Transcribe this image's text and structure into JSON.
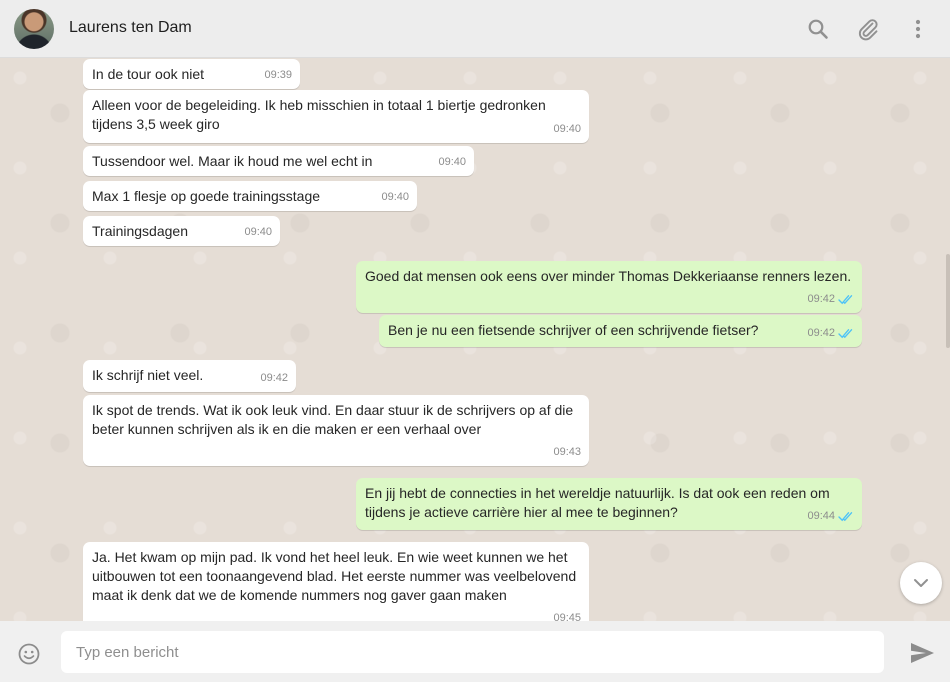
{
  "header": {
    "contact_name": "Laurens ten Dam",
    "icons": [
      "search-icon",
      "attach-icon",
      "menu-icon"
    ]
  },
  "messages": [
    {
      "direction": "in",
      "text": "In de tour ook niet",
      "time": "09:39"
    },
    {
      "direction": "in",
      "text": "Alleen voor de begeleiding. Ik heb misschien in totaal 1 biertje gedronken tijdens 3,5 week giro",
      "time": "09:40"
    },
    {
      "direction": "in",
      "text": "Tussendoor wel. Maar ik houd me wel echt in",
      "time": "09:40"
    },
    {
      "direction": "in",
      "text": "Max 1 flesje op goede trainingsstage",
      "time": "09:40"
    },
    {
      "direction": "in",
      "text": "Trainingsdagen",
      "time": "09:40"
    },
    {
      "direction": "out",
      "text": "Goed dat mensen ook eens over minder Thomas Dekkeriaanse renners lezen.",
      "time": "09:42",
      "status": "read"
    },
    {
      "direction": "out",
      "text": "Ben je nu een fietsende schrijver of een schrijvende fietser?",
      "time": "09:42",
      "status": "read"
    },
    {
      "direction": "in",
      "text": "Ik schrijf niet veel.",
      "time": "09:42"
    },
    {
      "direction": "in",
      "text": "Ik spot de trends. Wat ik ook leuk vind. En daar stuur ik de schrijvers op af die beter kunnen schrijven als ik en die maken er een verhaal over",
      "time": "09:43"
    },
    {
      "direction": "out",
      "text": "En jij hebt de connecties in het wereldje natuurlijk. Is dat ook een reden om tijdens je actieve carrière hier al mee te beginnen?",
      "time": "09:44",
      "status": "read"
    },
    {
      "direction": "in",
      "text": "Ja. Het kwam op mijn pad. Ik vond het heel leuk. En wie weet kunnen we het uitbouwen tot een toonaangevend blad. Het eerste nummer was veelbelovend maat ik denk dat we de komende nummers nog gaver gaan maken",
      "time": "09:45"
    }
  ],
  "composer": {
    "placeholder": "Typ een bericht",
    "icons": [
      "emoji-icon",
      "send-icon"
    ]
  },
  "colors": {
    "chat_background": "#e5ddd5",
    "incoming_bubble": "#ffffff",
    "outgoing_bubble": "#dcf8c6",
    "read_tick": "#4fc3f7"
  }
}
